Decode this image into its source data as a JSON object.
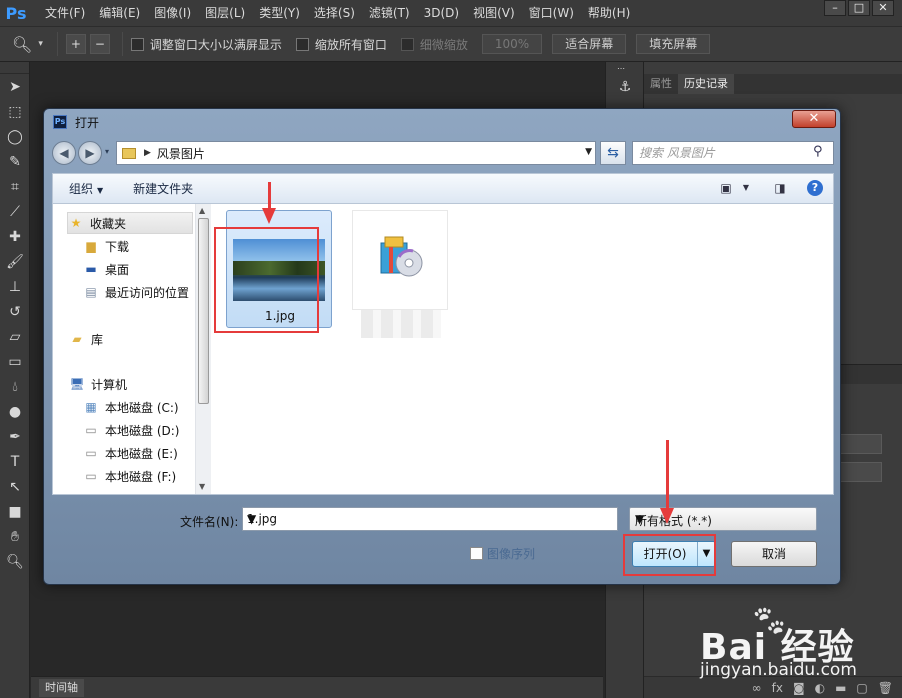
{
  "ps": {
    "logo": "Ps",
    "menus": [
      "文件(F)",
      "编辑(E)",
      "图像(I)",
      "图层(L)",
      "类型(Y)",
      "选择(S)",
      "滤镜(T)",
      "3D(D)",
      "视图(V)",
      "窗口(W)",
      "帮助(H)"
    ],
    "window_buttons": [
      "–",
      "□",
      "✕"
    ],
    "options": {
      "resize_windows": "调整窗口大小以满屏显示",
      "zoom_all": "缩放所有窗口",
      "scrubby_zoom": "细微缩放",
      "zoom_percent": "100%",
      "fit_screen": "适合屏幕",
      "fill_screen": "填充屏幕"
    },
    "panel_tabs": [
      "属性",
      "历史记录"
    ],
    "timeline_tab": "时间轴"
  },
  "dialog": {
    "icon": "Ps",
    "title": "打开",
    "close_label": "✕",
    "address": "风景图片",
    "search_placeholder": "搜索 风景图片",
    "toolbar": {
      "organize": "组织",
      "new_folder": "新建文件夹"
    },
    "nav": {
      "favorites": "收藏夹",
      "downloads": "下载",
      "desktop": "桌面",
      "recent": "最近访问的位置",
      "libraries": "库",
      "computer": "计算机",
      "drives": [
        "本地磁盘 (C:)",
        "本地磁盘 (D:)",
        "本地磁盘 (E:)",
        "本地磁盘 (F:)"
      ]
    },
    "files": [
      {
        "name": "1.jpg",
        "selected": true
      }
    ],
    "filename_label": "文件名(N):",
    "filename_value": "1.jpg",
    "filetype_value": "所有格式 (*.*)",
    "image_sequence": "图像序列",
    "open_button": "打开(O)",
    "cancel_button": "取消"
  },
  "watermark": {
    "logo": "Bai 经验",
    "sub": "jingyan.baidu.com"
  },
  "colors": {
    "annotation_red": "#e53b3b",
    "ps_accent": "#3d9bff"
  }
}
